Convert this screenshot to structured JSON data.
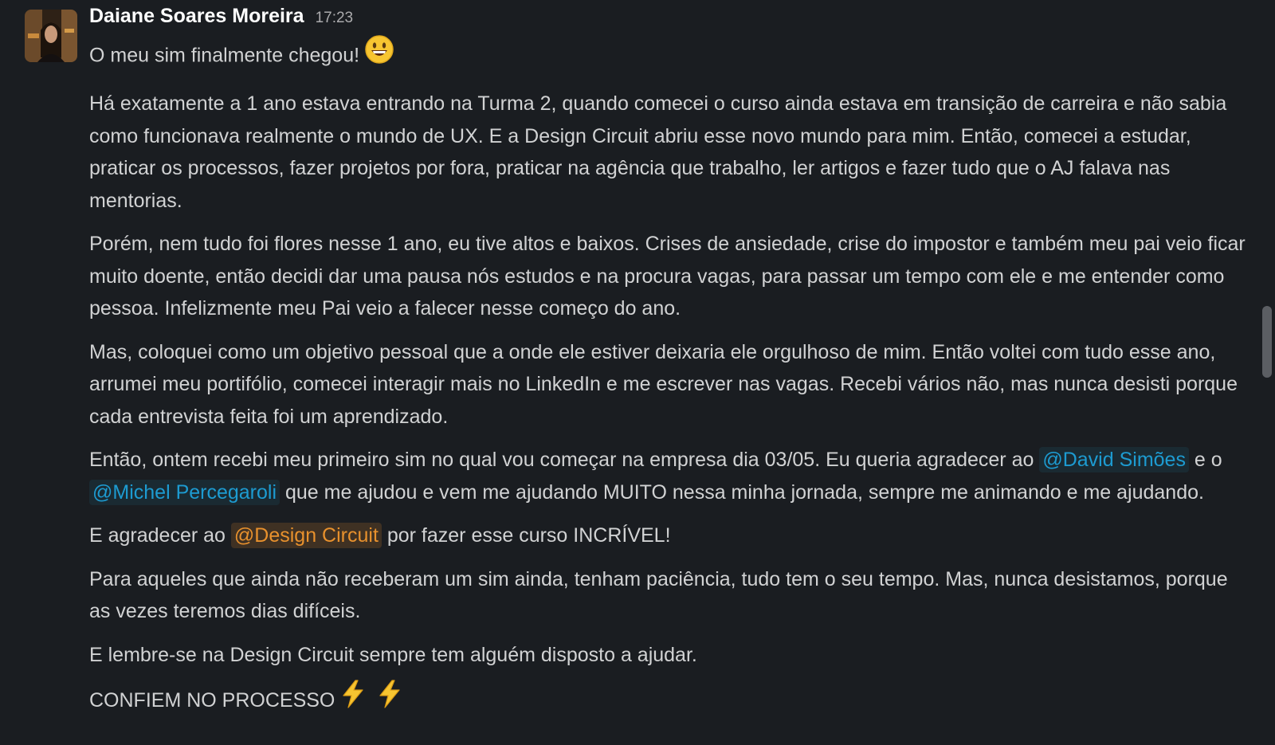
{
  "message": {
    "author": "Daiane Soares Moreira",
    "time": "17:23",
    "first_line": "O meu sim finalmente chegou!",
    "first_emoji": "grinning-face",
    "p1": "Há exatamente a 1 ano estava entrando na Turma 2, quando comecei o curso ainda estava em transição de carreira e não sabia como funcionava realmente o mundo de UX. E a Design Circuit abriu esse novo mundo para mim. Então, comecei a estudar, praticar os processos, fazer projetos por fora, praticar na agência que trabalho, ler artigos e fazer tudo que o AJ falava nas mentorias.",
    "p2": "Porém, nem tudo foi flores nesse 1 ano, eu tive altos e baixos. Crises de ansiedade, crise do impostor e também meu pai veio ficar muito doente, então decidi dar uma pausa nós estudos e na procura vagas, para passar um tempo com ele e me entender como pessoa. Infelizmente meu Pai veio a falecer nesse começo do ano.",
    "p3": "Mas, coloquei como um objetivo pessoal que a onde ele estiver deixaria ele orgulhoso de mim. Então voltei com tudo esse ano, arrumei meu portifólio, comecei interagir mais no LinkedIn e me escrever nas vagas. Recebi vários não, mas nunca desisti porque cada entrevista feita foi um aprendizado.",
    "p4_a": "Então, ontem recebi meu primeiro sim no qual vou começar na empresa dia 03/05. Eu queria agradecer ao",
    "mention_1": "@David Simões",
    "p4_b": "e o",
    "mention_2": "@Michel Percegaroli",
    "p4_c": "que me ajudou e vem me ajudando MUITO nessa minha jornada, sempre me animando e me ajudando.",
    "p5_a": "E agradecer ao",
    "mention_3": "@Design Circuit",
    "p5_b": "por fazer esse curso INCRÍVEL!",
    "p6": "Para aqueles que ainda não receberam um sim ainda, tenham paciência, tudo tem o seu tempo. Mas, nunca desistamos, porque as vezes teremos dias difíceis.",
    "p7": "E lembre-se na Design Circuit sempre tem alguém disposto a ajudar.",
    "p8": "CONFIEM NO PROCESSO",
    "p8_emojis": [
      "high-voltage",
      "high-voltage"
    ]
  },
  "colors": {
    "background": "#1a1d21",
    "text": "#d1d2d3",
    "mention_user": "#1d9bd1",
    "mention_group": "#e8912d"
  }
}
